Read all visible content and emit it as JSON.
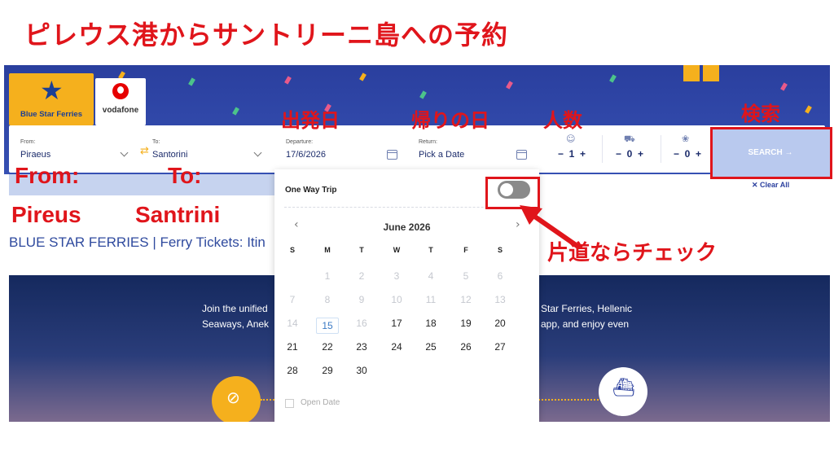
{
  "title": "ピレウス港からサントリーニ島への予約",
  "logos": {
    "bsf": "Blue Star Ferries",
    "voda": "vodafone"
  },
  "search": {
    "from_label": "From:",
    "from_value": "Piraeus",
    "to_label": "To:",
    "to_value": "Santorini",
    "departure_label": "Departure:",
    "departure_value": "17/6/2026",
    "return_label": "Return:",
    "return_value": "Pick a Date",
    "passengers_value": "1",
    "vehicles_value": "0",
    "pets_value": "0",
    "search_button": "SEARCH →",
    "clear_all": "✕ Clear All"
  },
  "page_text": {
    "tickets_line": "BLUE STAR FERRIES | Ferry Tickets: Itin",
    "hero_left_1": "Join the unified",
    "hero_left_2": "Seaways, Anek",
    "hero_right_1": "e Star Ferries, Hellenic",
    "hero_right_2": "e app, and enjoy even"
  },
  "calendar": {
    "one_way_label": "One Way Trip",
    "one_way_enabled": false,
    "month": "June 2026",
    "prev": "‹",
    "next": "›",
    "weekdays": [
      "S",
      "M",
      "T",
      "W",
      "T",
      "F",
      "S"
    ],
    "weeks": [
      [
        "",
        "1",
        "2",
        "3",
        "4",
        "5",
        "6"
      ],
      [
        "7",
        "8",
        "9",
        "10",
        "11",
        "12",
        "13"
      ],
      [
        "14",
        "15",
        "16",
        "17",
        "18",
        "19",
        "20"
      ],
      [
        "21",
        "22",
        "23",
        "24",
        "25",
        "26",
        "27"
      ],
      [
        "28",
        "29",
        "30",
        "",
        "",
        "",
        ""
      ]
    ],
    "today": "15",
    "last_past_day": 16,
    "open_date": "Open Date"
  },
  "annotations": {
    "departure": "出発日",
    "return": "帰りの日",
    "people": "人数",
    "search": "検索",
    "from_head": "From:",
    "from_value": "Pireus",
    "to_head": "To:",
    "to_value": "Santrini",
    "one_way_note": "片道ならチェック"
  },
  "colors": {
    "annotation_red": "#e0151b",
    "header_blue": "#2a3f9e",
    "brand_yellow": "#f5b01d",
    "search_button": "#b9c9ee"
  }
}
